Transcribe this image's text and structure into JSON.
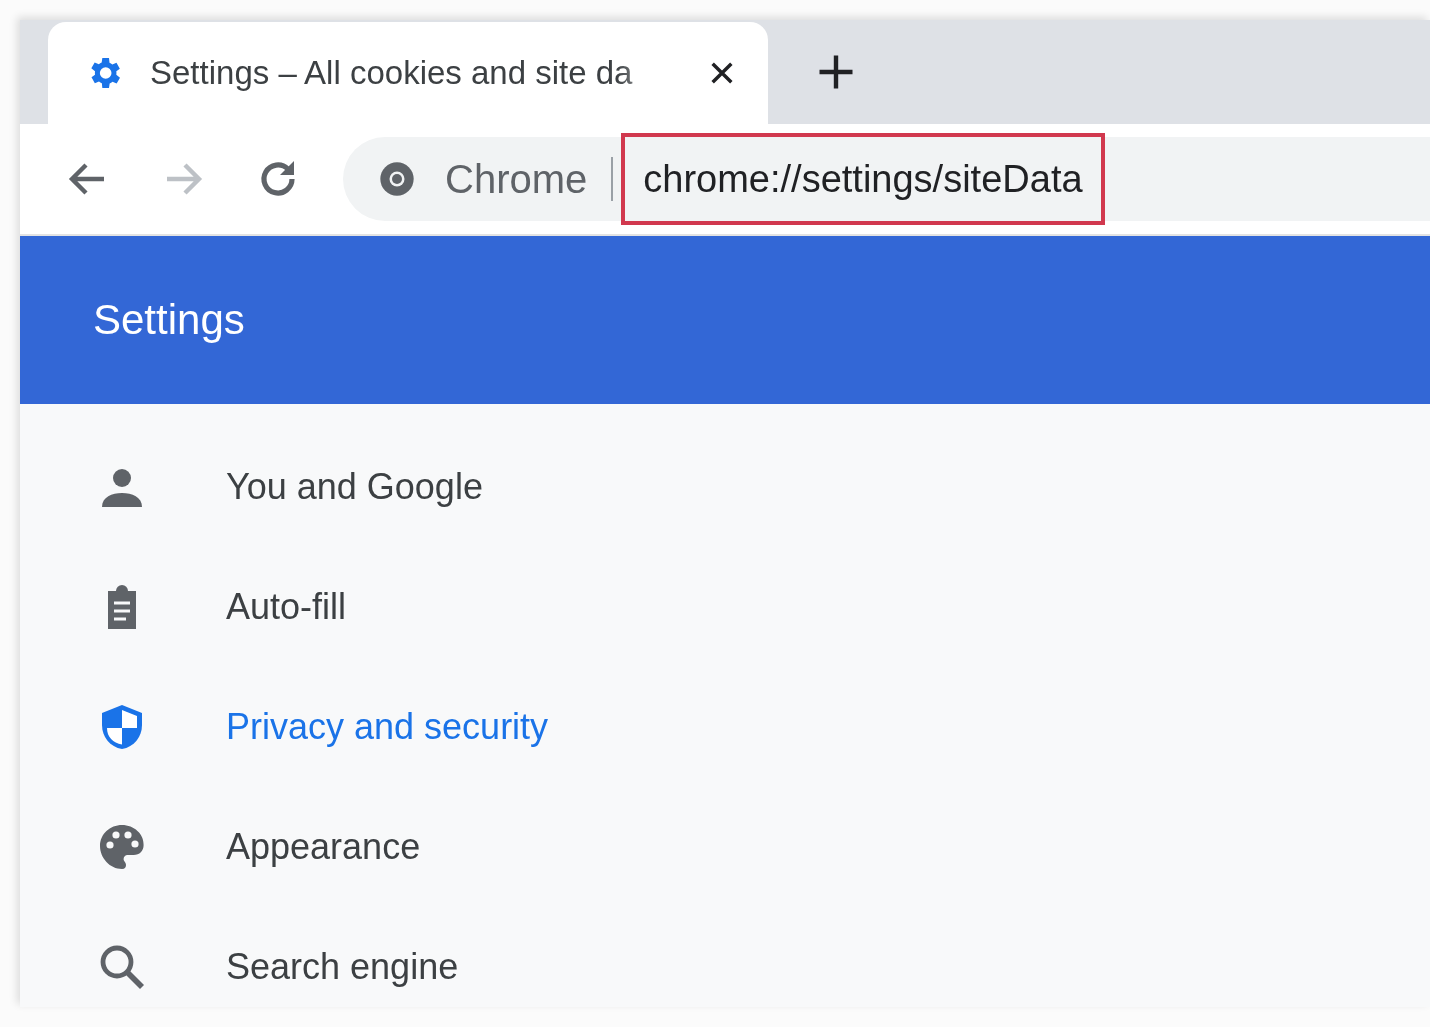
{
  "tab": {
    "title": "Settings – All cookies and site da",
    "selected": true
  },
  "toolbar": {
    "chip": "Chrome",
    "address": "chrome://settings/siteData",
    "address_highlighted": true,
    "forward_disabled": true
  },
  "header": {
    "title": "Settings"
  },
  "sidebar": {
    "items": [
      {
        "label": "You and Google",
        "selected": false
      },
      {
        "label": "Auto-fill",
        "selected": false
      },
      {
        "label": "Privacy and security",
        "selected": true
      },
      {
        "label": "Appearance",
        "selected": false
      },
      {
        "label": "Search engine",
        "selected": false
      }
    ]
  }
}
